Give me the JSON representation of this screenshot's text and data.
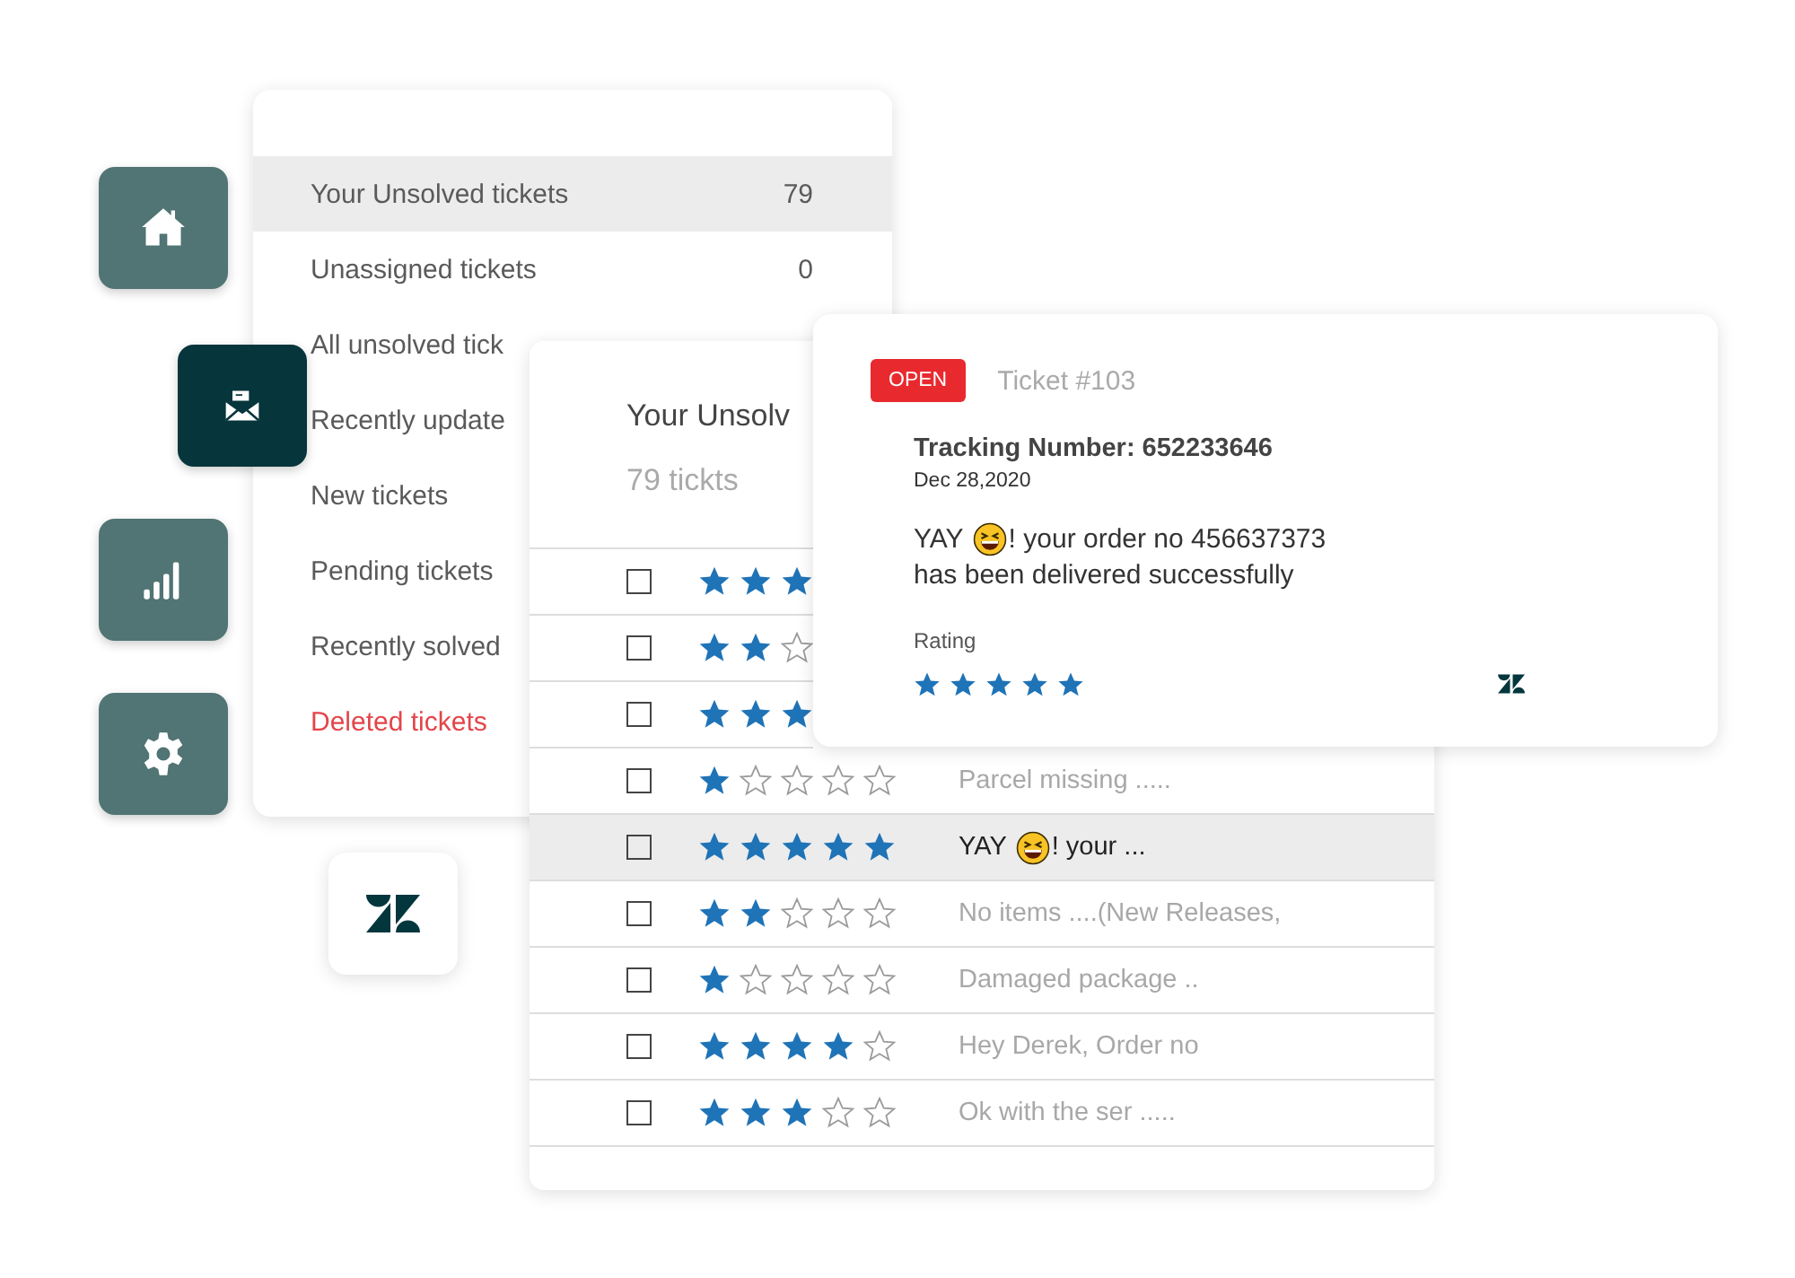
{
  "side_buttons": [
    {
      "kind": "home"
    },
    {
      "kind": "mail"
    },
    {
      "kind": "signal"
    },
    {
      "kind": "settings"
    }
  ],
  "views": [
    {
      "label": "Your Unsolved tickets",
      "count": "79",
      "selected": true,
      "kind": "normal"
    },
    {
      "label": "Unassigned tickets",
      "count": "0",
      "selected": false,
      "kind": "normal"
    },
    {
      "label": "All unsolved tick",
      "selected": false,
      "kind": "normal"
    },
    {
      "label": "Recently update",
      "selected": false,
      "kind": "normal"
    },
    {
      "label": "New tickets",
      "selected": false,
      "kind": "normal"
    },
    {
      "label": "Pending tickets",
      "selected": false,
      "kind": "normal"
    },
    {
      "label": "Recently solved",
      "selected": false,
      "kind": "normal"
    },
    {
      "label": "Deleted tickets",
      "selected": false,
      "kind": "danger"
    }
  ],
  "ticket_list": {
    "title": "Your Unsolv",
    "count": "79 tickts",
    "rows": [
      {
        "checked": false,
        "selected": false,
        "stars": 3
      },
      {
        "checked": false,
        "selected": false,
        "stars": 2
      },
      {
        "checked": false,
        "selected": false,
        "stars": 3
      },
      {
        "checked": false,
        "selected": false,
        "stars": 1,
        "preview": "Parcel missing ....."
      },
      {
        "checked": false,
        "selected": true,
        "stars": 5,
        "preview": "! your ...",
        "preview_lead": "YAY"
      },
      {
        "checked": false,
        "selected": false,
        "stars": 2,
        "preview": "No items ....(New Releases,"
      },
      {
        "checked": false,
        "selected": false,
        "stars": 1,
        "preview": "Damaged package .."
      },
      {
        "checked": false,
        "selected": false,
        "stars": 4,
        "preview": "Hey Derek, Order no"
      },
      {
        "checked": false,
        "selected": false,
        "stars": 3,
        "preview": "Ok with the ser ....."
      }
    ]
  },
  "ticket": {
    "status": "OPEN",
    "number": "Ticket #103",
    "tracking": "Tracking Number: 652233646",
    "date": "Dec 28,2020",
    "message_lead": "YAY",
    "message_line1": "! your order no 456637373",
    "message_line2": "has been delivered successfully",
    "rating_label": "Rating",
    "stars": 5
  }
}
